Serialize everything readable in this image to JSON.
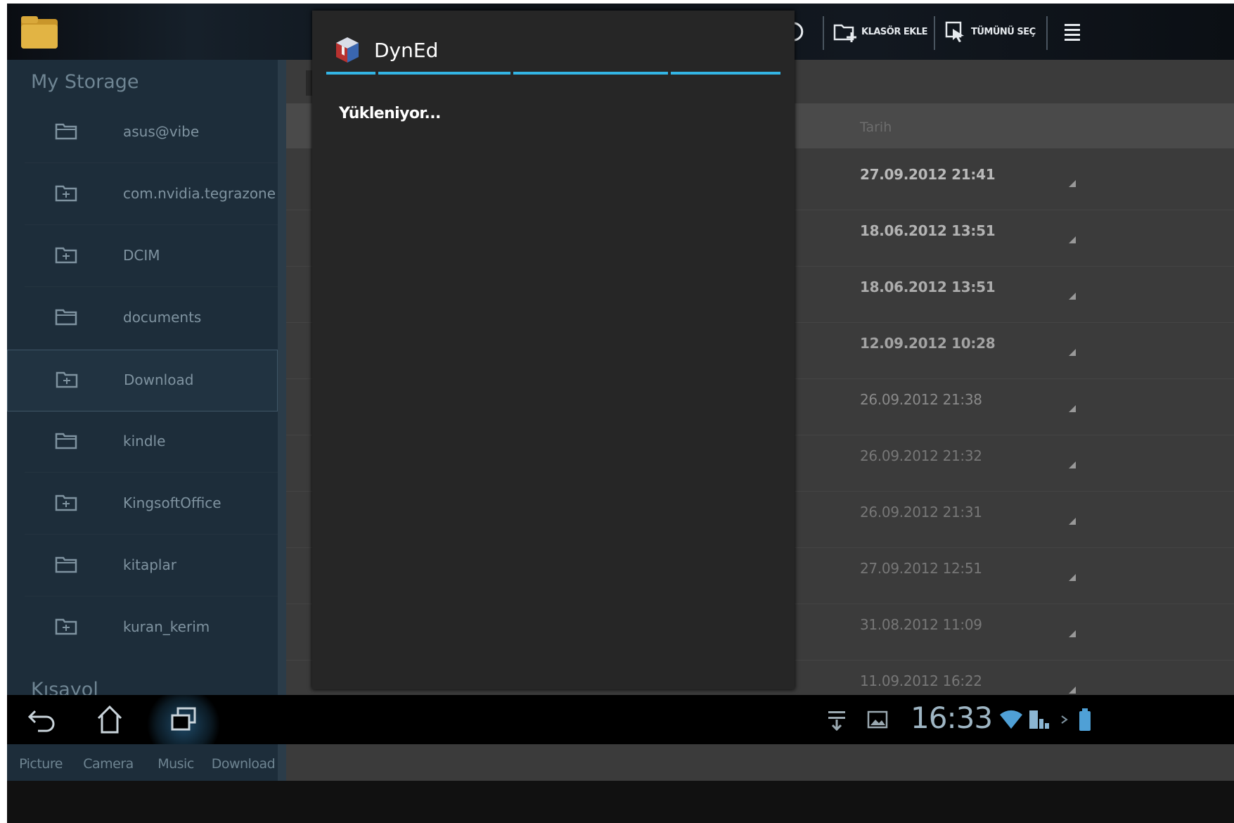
{
  "action_bar": {
    "new_folder_label": "KLASÖR EKLE",
    "select_all_label": "TÜMÜNÜ SEÇ"
  },
  "sidebar": {
    "storage_title": "My Storage",
    "items": [
      {
        "label": "asus@vibe",
        "icon": "folder-icon"
      },
      {
        "label": "com.nvidia.tegrazone",
        "icon": "folder-icon"
      },
      {
        "label": "DCIM",
        "icon": "folder-icon"
      },
      {
        "label": "documents",
        "icon": "folder-icon"
      },
      {
        "label": "Download",
        "icon": "folder-icon"
      },
      {
        "label": "kindle",
        "icon": "folder-icon"
      },
      {
        "label": "KingsoftOffice",
        "icon": "folder-icon"
      },
      {
        "label": "kitaplar",
        "icon": "folder-icon"
      },
      {
        "label": "kuran_kerim",
        "icon": "folder-icon"
      }
    ],
    "selected": "Download",
    "shortcuts_title": "Kısayol",
    "shortcuts": [
      {
        "label": "Picture",
        "icon": "picture-icon"
      },
      {
        "label": "Camera",
        "icon": "camera-icon"
      },
      {
        "label": "Music",
        "icon": "music-icon"
      },
      {
        "label": "Download",
        "icon": "download-icon"
      }
    ]
  },
  "file_list": {
    "date_column_header": "Tarih",
    "rows": [
      {
        "date": "27.09.2012 21:41"
      },
      {
        "date": "18.06.2012 13:51"
      },
      {
        "date": "18.06.2012 13:51"
      },
      {
        "date": "12.09.2012 10:28"
      },
      {
        "date": "26.09.2012 21:38"
      },
      {
        "date": "26.09.2012 21:32"
      },
      {
        "date": "26.09.2012 21:31"
      },
      {
        "date": "27.09.2012 12:51"
      },
      {
        "date": "31.08.2012 11:09"
      },
      {
        "date": "11.09.2012 16:22"
      }
    ]
  },
  "dialog": {
    "title": "DynEd",
    "message": "Yükleniyor..."
  },
  "system_bar": {
    "clock": "16:33"
  },
  "colors": {
    "accent": "#33b5e5",
    "sidebar_bg": "#1d2d3a",
    "dialog_bg": "#262626"
  }
}
